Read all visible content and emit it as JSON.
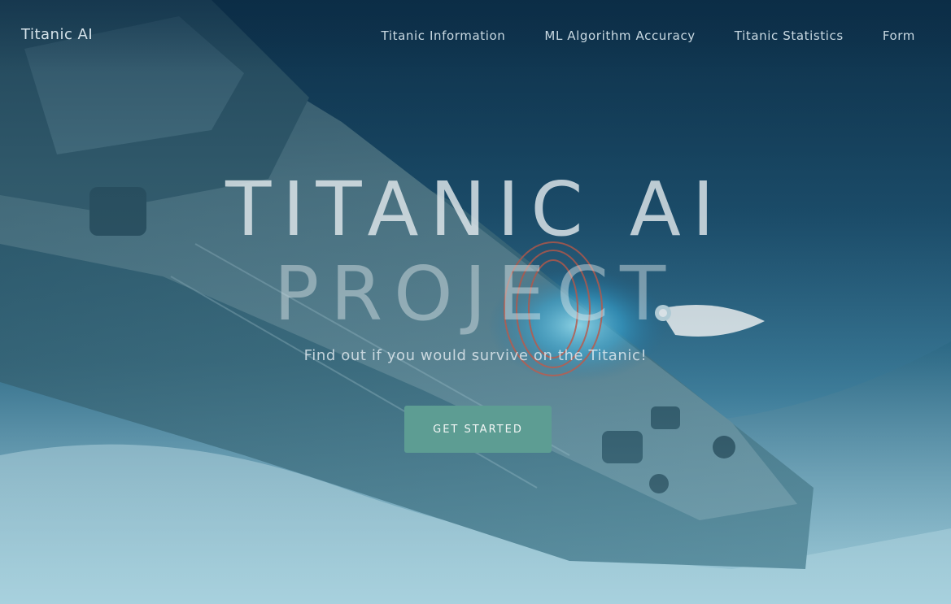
{
  "navbar": {
    "brand": "Titanic AI",
    "links": [
      {
        "label": "Titanic Information"
      },
      {
        "label": "ML Algorithm Accuracy"
      },
      {
        "label": "Titanic Statistics"
      },
      {
        "label": "Form"
      }
    ]
  },
  "hero": {
    "title_line1": "TITANIC AI",
    "title_line2": "PROJECT",
    "subtitle": "Find out if you would survive on the Titanic!",
    "cta_label": "GET STARTED"
  },
  "colors": {
    "accent_button": "#5d9d93",
    "ocean_dark": "#0f3650",
    "seafloor_light": "#a6cfdc"
  }
}
